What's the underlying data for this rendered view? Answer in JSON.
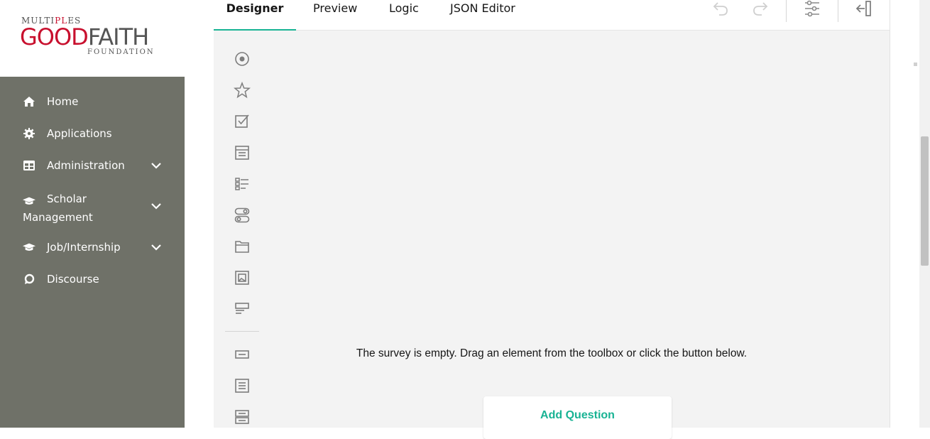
{
  "logo": {
    "multiples_a": "MULTI",
    "multiples_b": "PL",
    "multiples_c": "ES",
    "good": "GOOD",
    "faith": "FAITH",
    "foundation": "FOUNDATION"
  },
  "sidebar": {
    "items": [
      {
        "label": "Home",
        "icon": "home-icon"
      },
      {
        "label": "Applications",
        "icon": "gear-icon"
      },
      {
        "label": "Administration",
        "icon": "table-icon"
      },
      {
        "label_line1": "Scholar",
        "label_line2": "Management",
        "icon": "graduation-cap-icon"
      },
      {
        "label": "Job/Internship",
        "icon": "graduation-cap-icon"
      },
      {
        "label": "Discourse",
        "icon": "chat-icon"
      }
    ]
  },
  "tabs": [
    {
      "label": "Designer"
    },
    {
      "label": "Preview"
    },
    {
      "label": "Logic"
    },
    {
      "label": "JSON Editor"
    }
  ],
  "toolbar": {
    "icons": [
      "undo-icon",
      "redo-icon",
      "settings-sliders-icon",
      "collapse-panel-icon"
    ]
  },
  "toolbox": {
    "icons": [
      "radiogroup-icon",
      "rating-icon",
      "checkbox-icon",
      "dropdown-icon",
      "ranking-icon",
      "boolean-icon",
      "file-icon",
      "imagepicker-icon",
      "tagbox-icon",
      "text-input-icon",
      "comment-icon",
      "multiple-text-icon"
    ]
  },
  "survey": {
    "empty_message": "The survey is empty. Drag an element from the toolbox or click the button below.",
    "add_question_label": "Add Question"
  },
  "colors": {
    "sidebar_bg": "#6f7168",
    "accent": "#19b394",
    "brand_red": "#c8102e"
  }
}
